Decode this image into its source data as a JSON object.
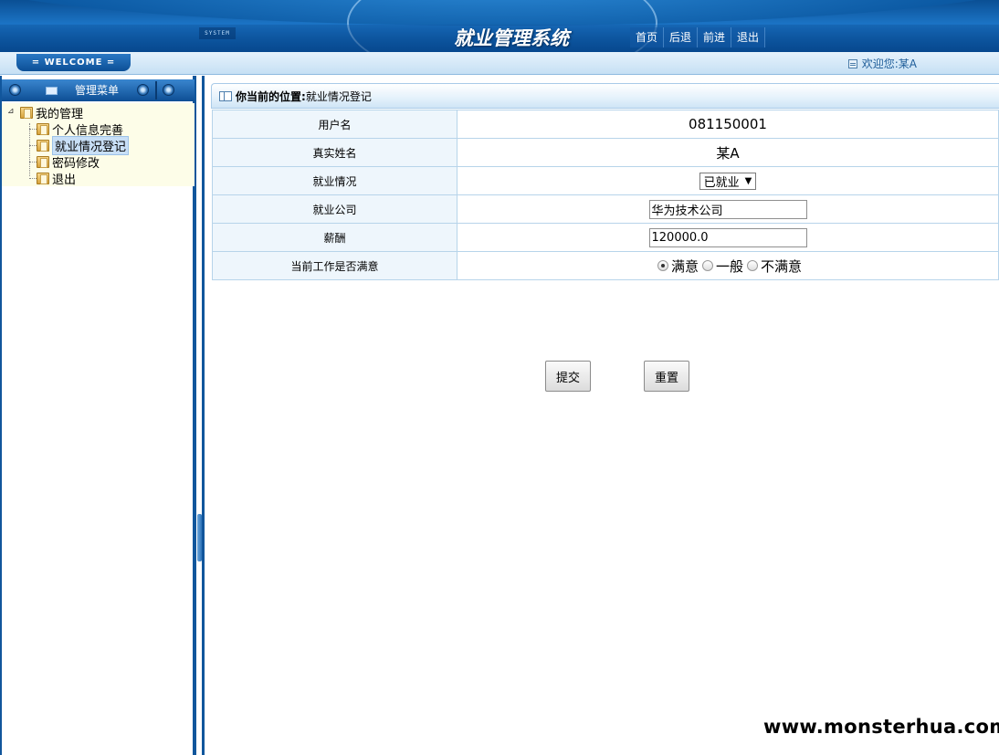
{
  "header": {
    "system_tag": "SYSTEM",
    "title": "就业管理系统",
    "nav": [
      {
        "label": "首页"
      },
      {
        "label": "后退"
      },
      {
        "label": "前进"
      },
      {
        "label": "退出"
      }
    ]
  },
  "welcome_bar": {
    "tab_label": "= WELCOME =",
    "greeting": "欢迎您:某A"
  },
  "sidebar": {
    "menu_title": "管理菜单",
    "tree": {
      "root": "我的管理",
      "items": [
        {
          "label": "个人信息完善"
        },
        {
          "label": "就业情况登记"
        },
        {
          "label": "密码修改"
        },
        {
          "label": "退出"
        }
      ]
    }
  },
  "main": {
    "location_label": "你当前的位置:",
    "location_value": "就业情况登记",
    "form": {
      "username_label": "用户名",
      "username_value": "081150001",
      "realname_label": "真实姓名",
      "realname_value": "某A",
      "employment_label": "就业情况",
      "employment_value": "已就业",
      "company_label": "就业公司",
      "company_value": "华为技术公司",
      "salary_label": "薪酬",
      "salary_value": "120000.0",
      "satisfaction_label": "当前工作是否满意",
      "satisfaction_options": [
        {
          "label": "满意"
        },
        {
          "label": "一般"
        },
        {
          "label": "不满意"
        }
      ]
    },
    "submit_label": "提交",
    "reset_label": "重置"
  },
  "watermark": "www.monsterhua.com",
  "colors": {
    "banner_blue": "#0a5aa8",
    "frame_blue": "#11569c",
    "tree_bg": "#fdfde8",
    "label_cell_bg": "#eef6fc"
  }
}
